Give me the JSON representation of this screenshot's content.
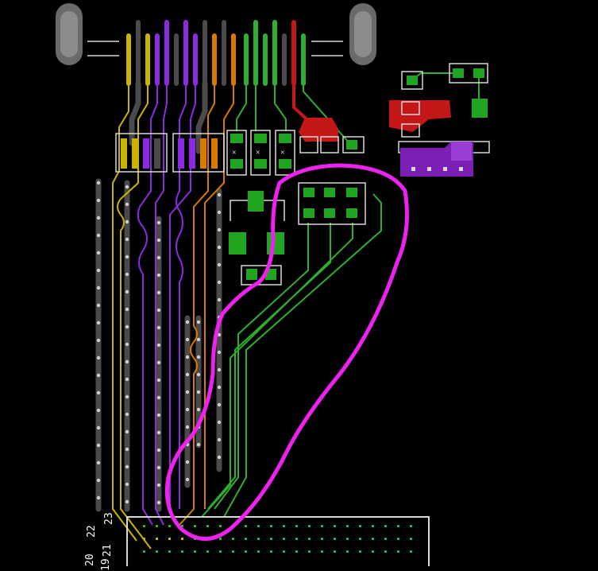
{
  "pin_labels": [
    "23",
    "22",
    "21",
    "20",
    "19"
  ],
  "colors": {
    "background": "#000000",
    "trace_yellow": "#c8b400",
    "trace_purple": "#8a2be2",
    "trace_orange": "#d97a00",
    "trace_green": "#2fae2f",
    "trace_gray": "#4a4a4a",
    "via_dot": "#cfcfcf",
    "pad_green": "#1fa51f",
    "pad_red": "#c41818",
    "pad_purple": "#7b1fb5",
    "outline_white": "#d8d8d8",
    "annotation_magenta": "#ee22ee"
  }
}
